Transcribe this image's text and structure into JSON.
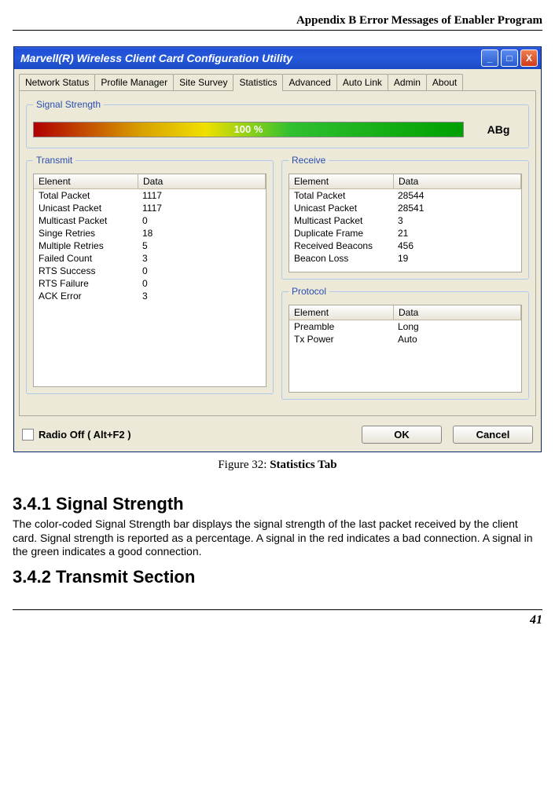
{
  "header": "Appendix B Error Messages of Enabler Program",
  "window": {
    "title": "Marvell(R) Wireless Client Card Configuration Utility",
    "buttons": {
      "min": "_",
      "max": "□",
      "close": "X"
    },
    "tabs": [
      "Network Status",
      "Profile Manager",
      "Site Survey",
      "Statistics",
      "Advanced",
      "Auto Link",
      "Admin",
      "About"
    ],
    "active_tab_index": 3
  },
  "signal": {
    "legend": "Signal Strength",
    "percent_text": "100 %",
    "icon_text": "ABg"
  },
  "transmit": {
    "legend": "Transmit",
    "cols": {
      "elem": "Elenent",
      "data": "Data"
    },
    "rows": [
      {
        "elem": "Total Packet",
        "data": "1117"
      },
      {
        "elem": "Unicast Packet",
        "data": "1117"
      },
      {
        "elem": "Multicast Packet",
        "data": "0"
      },
      {
        "elem": "Singe Retries",
        "data": "18"
      },
      {
        "elem": "Multiple Retries",
        "data": "5"
      },
      {
        "elem": "Failed Count",
        "data": "3"
      },
      {
        "elem": "RTS Success",
        "data": "0"
      },
      {
        "elem": "RTS Failure",
        "data": "0"
      },
      {
        "elem": "ACK Error",
        "data": "3"
      }
    ]
  },
  "receive": {
    "legend": "Receive",
    "cols": {
      "elem": "Element",
      "data": "Data"
    },
    "rows": [
      {
        "elem": "Total Packet",
        "data": "28544"
      },
      {
        "elem": "Unicast Packet",
        "data": "28541"
      },
      {
        "elem": "Multicast Packet",
        "data": "3"
      },
      {
        "elem": "Duplicate Frame",
        "data": "21"
      },
      {
        "elem": "Received Beacons",
        "data": "456"
      },
      {
        "elem": "Beacon Loss",
        "data": "19"
      }
    ]
  },
  "protocol": {
    "legend": "Protocol",
    "cols": {
      "elem": "Element",
      "data": "Data"
    },
    "rows": [
      {
        "elem": "Preamble",
        "data": "Long"
      },
      {
        "elem": "Tx Power",
        "data": "Auto"
      }
    ]
  },
  "bottom": {
    "radio_label": "Radio Off  ( Alt+F2 )",
    "ok": "OK",
    "cancel": "Cancel"
  },
  "caption_prefix": "Figure 32: ",
  "caption_bold": "Statistics Tab",
  "section1": {
    "heading": "3.4.1 Signal Strength",
    "body": "The color-coded Signal Strength bar displays the signal strength of the last packet received by the client card. Signal strength is reported as a percentage. A signal in the red indicates a bad connection. A signal in the green indicates a good connection."
  },
  "section2": {
    "heading": "3.4.2 Transmit Section"
  },
  "page_number": "41"
}
